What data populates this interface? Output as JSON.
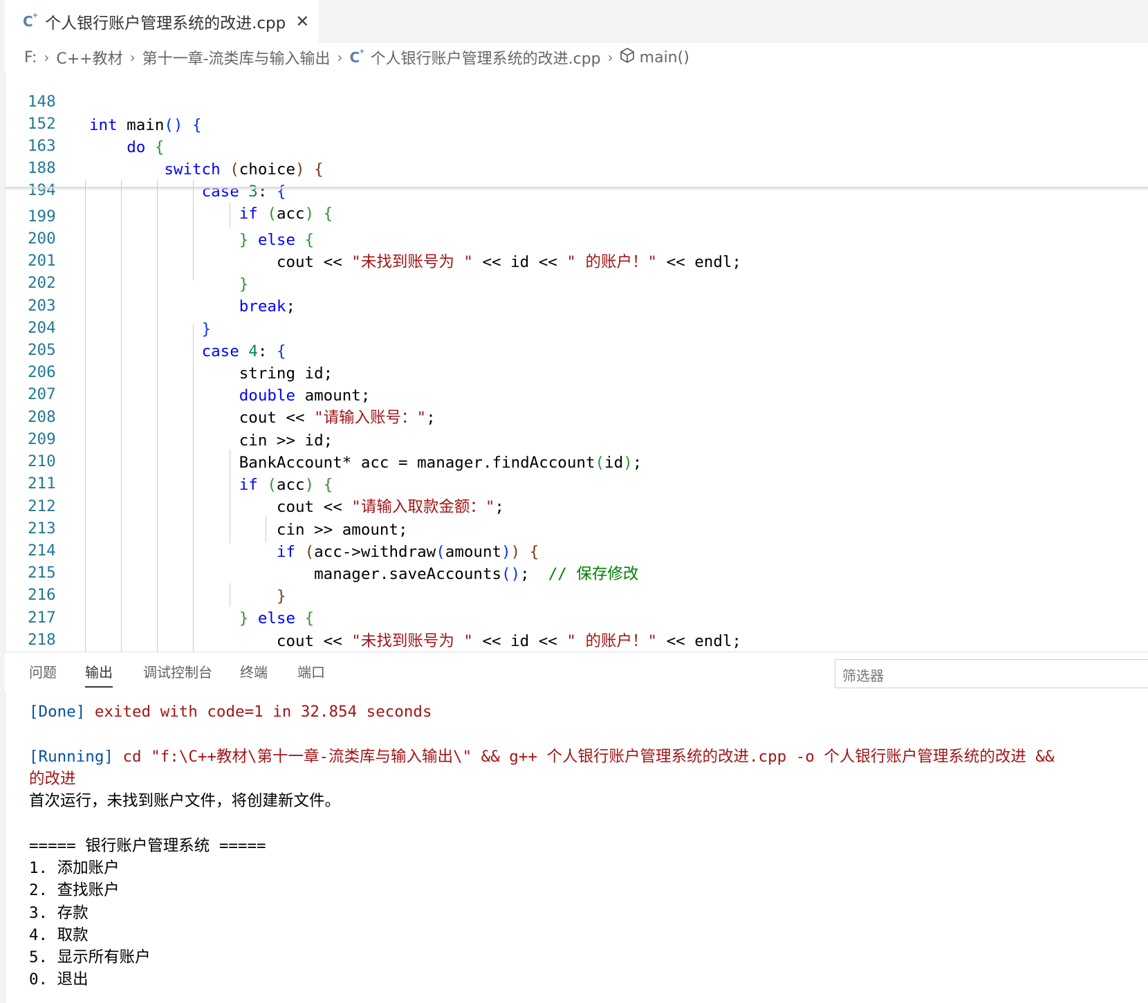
{
  "tab": {
    "title": "个人银行账户管理系统的改进.cpp",
    "close": "✕"
  },
  "breadcrumb": {
    "drive": "F:",
    "folder1": "C++教材",
    "folder2": "第十一章-流类库与输入输出",
    "file": "个人银行账户管理系统的改进.cpp",
    "symbol": "main()"
  },
  "editor": {
    "sticky": [
      {
        "ln": "148"
      },
      {
        "ln": "152"
      },
      {
        "ln": "163"
      },
      {
        "ln": "188"
      },
      {
        "ln": "194"
      }
    ],
    "lines": [
      {
        "ln": "199"
      },
      {
        "ln": "200"
      },
      {
        "ln": "201"
      },
      {
        "ln": "202"
      },
      {
        "ln": "203"
      },
      {
        "ln": "204"
      },
      {
        "ln": "205"
      },
      {
        "ln": "206"
      },
      {
        "ln": "207"
      },
      {
        "ln": "208"
      },
      {
        "ln": "209"
      },
      {
        "ln": "210"
      },
      {
        "ln": "211"
      },
      {
        "ln": "212"
      },
      {
        "ln": "213"
      },
      {
        "ln": "214"
      },
      {
        "ln": "215"
      },
      {
        "ln": "216"
      },
      {
        "ln": "217"
      },
      {
        "ln": "218"
      }
    ],
    "str_not_found_a": "\"未找到账号为 \"",
    "str_not_found_b": "\" 的账户！\"",
    "str_enter_id": "\"请输入账号：\"",
    "str_enter_amount": "\"请输入取款金额：\"",
    "comment_save": "// 保存修改"
  },
  "panel": {
    "tabs": [
      "问题",
      "输出",
      "调试控制台",
      "终端",
      "端口"
    ],
    "active_tab": "输出",
    "filter_placeholder": "筛选器"
  },
  "output": {
    "done_tag": "[Done]",
    "done_text": "exited with code=1 in 32.854 seconds",
    "running_tag": "[Running]",
    "running_cmd": "cd \"f:\\C++教材\\第十一章-流类库与输入输出\\\" && g++ 个人银行账户管理系统的改进.cpp -o 个人银行账户管理系统的改进 &&",
    "running_cont": "的改进",
    "lines": [
      "首次运行，未找到账户文件，将创建新文件。",
      "",
      "===== 银行账户管理系统 =====",
      "1. 添加账户",
      "2. 查找账户",
      "3. 存款",
      "4. 取款",
      "5. 显示所有账户",
      "0. 退出"
    ]
  },
  "colors": {
    "keyword": "#0000ff",
    "string": "#a31515",
    "comment": "#008000",
    "line_number": "#237893",
    "number": "#098658"
  },
  "icons": [
    "cpp-file-icon",
    "close-icon",
    "chevron-right-icon",
    "cube-symbol-icon"
  ]
}
